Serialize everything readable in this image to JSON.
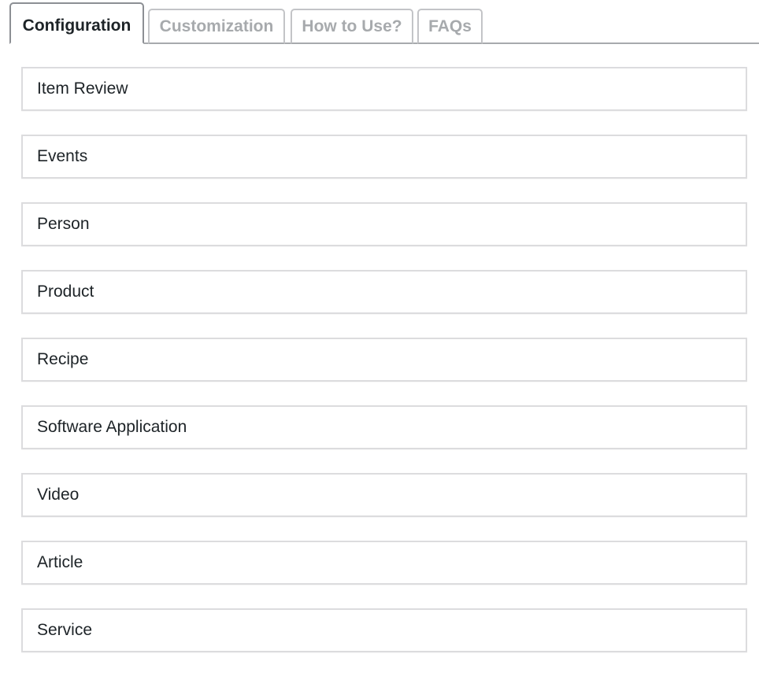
{
  "tabs": [
    {
      "label": "Configuration",
      "active": true
    },
    {
      "label": "Customization",
      "active": false
    },
    {
      "label": "How to Use?",
      "active": false
    },
    {
      "label": "FAQs",
      "active": false
    }
  ],
  "panels": [
    {
      "title": "Item Review"
    },
    {
      "title": "Events"
    },
    {
      "title": "Person"
    },
    {
      "title": "Product"
    },
    {
      "title": "Recipe"
    },
    {
      "title": "Software Application"
    },
    {
      "title": "Video"
    },
    {
      "title": "Article"
    },
    {
      "title": "Service"
    }
  ],
  "colors": {
    "active_tab_text": "#1d2327",
    "inactive_tab_text": "#a7aaad",
    "panel_border": "#dcdcde"
  }
}
